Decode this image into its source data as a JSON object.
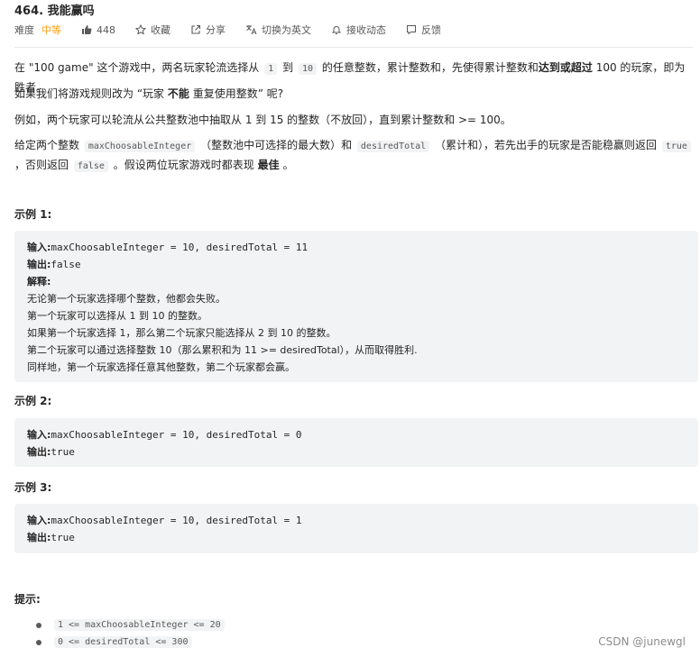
{
  "problem": {
    "title": "464. 我能赢吗",
    "difficulty_label": "难度",
    "difficulty": "中等",
    "likes": "448",
    "collect": "收藏",
    "share": "分享",
    "switch_lang": "切换为英文",
    "notify": "接收动态",
    "feedback": "反馈"
  },
  "description": {
    "p1_a": "在 \"100 game\" 这个游戏中，两名玩家轮流选择从",
    "p1_code1": "1",
    "p1_b": "到",
    "p1_code2": "10",
    "p1_c": "的任意整数，累计整数和，先使得累计整数和",
    "p1_bold": "达到或超过",
    "p1_d": "100 的玩家，即为胜者。",
    "p2_a": "如果我们将游戏规则改为 “玩家",
    "p2_bold": "不能",
    "p2_b": "重复使用整数” 呢?",
    "p3": "例如，两个玩家可以轮流从公共整数池中抽取从 1 到 15 的整数（不放回），直到累计整数和 >= 100。",
    "p4_a": "给定两个整数",
    "p4_code1": "maxChoosableInteger",
    "p4_b": "（整数池中可选择的最大数）和",
    "p4_code2": "desiredTotal",
    "p4_c": "（累计和），若先出手的玩家是否能稳赢则返回",
    "p4_code3": "true",
    "p4_d": "，否则返回",
    "p4_code4": "false",
    "p4_e": "。假设两位玩家游戏时都表现",
    "p4_bold": "最佳",
    "p4_f": "。"
  },
  "examples": [
    {
      "title": "示例 1:",
      "input_label": "输入:",
      "input": "maxChoosableInteger = 10, desiredTotal = 11",
      "output_label": "输出:",
      "output": "false",
      "explain_label": "解释:",
      "explain": [
        "无论第一个玩家选择哪个整数，他都会失败。",
        "第一个玩家可以选择从 1 到 10 的整数。",
        "如果第一个玩家选择 1，那么第二个玩家只能选择从 2 到 10 的整数。",
        "第二个玩家可以通过选择整数 10（那么累积和为 11 >= desiredTotal），从而取得胜利.",
        "同样地，第一个玩家选择任意其他整数，第二个玩家都会赢。"
      ]
    },
    {
      "title": "示例 2:",
      "input_label": "输入:",
      "input": "maxChoosableInteger = 10, desiredTotal = 0",
      "output_label": "输出:",
      "output": "true"
    },
    {
      "title": "示例 3:",
      "input_label": "输入:",
      "input": "maxChoosableInteger = 10, desiredTotal = 1",
      "output_label": "输出:",
      "output": "true"
    }
  ],
  "hints": {
    "title": "提示:",
    "items": [
      "1 <= maxChoosableInteger <= 20",
      "0 <= desiredTotal <= 300"
    ]
  },
  "watermark": "CSDN @junewgl",
  "colors": {
    "difficulty": "#ffa116",
    "code_bg": "#f2f3f4"
  }
}
